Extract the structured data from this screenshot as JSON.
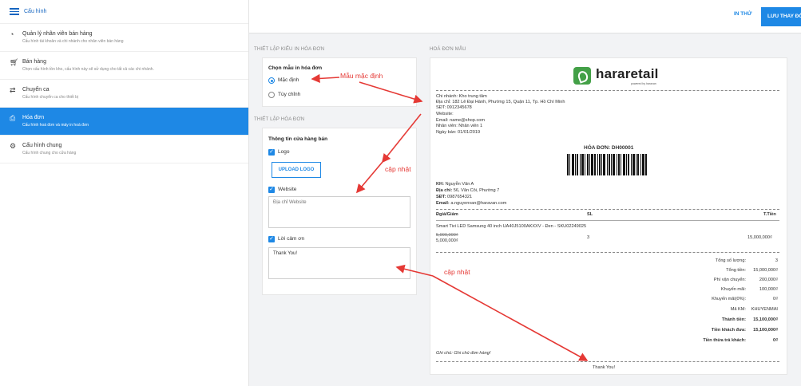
{
  "sidebar": {
    "title": "Cấu hình",
    "items": [
      {
        "label": "Quản lý nhân viên bán hàng",
        "sub": "Cấu hình tài khoản và chi nhánh cho nhân viên bán hàng"
      },
      {
        "label": "Bán hàng",
        "sub": "Chọn cấu hình tồn kho, cấu hình này sẽ sử dụng cho tất cả các chi nhánh."
      },
      {
        "label": "Chuyển ca",
        "sub": "Cấu hình chuyển ca cho thiết bị"
      },
      {
        "label": "Hóa đơn",
        "sub": "Cấu hình hoá đơn và máy in hoá đơn"
      },
      {
        "label": "Cấu hình chung",
        "sub": "Cấu hình chung cho cửa hàng"
      }
    ]
  },
  "topbar": {
    "print_label": "IN THỬ",
    "save_label": "LƯU THAY ĐỔI"
  },
  "settings": {
    "print_section_title": "THIẾT LẬP KIỂU IN HÓA ĐƠN",
    "template_label": "Chọn mẫu in hóa đơn",
    "option_default": "Mặc định",
    "option_custom": "Tùy chỉnh",
    "invoice_section_title": "THIẾT LẬP HÓA ĐƠN",
    "store_info_label": "Thông tin cửa hàng bán",
    "logo_label": "Logo",
    "upload_label": "UPLOAD LOGO",
    "website_label": "Website",
    "website_placeholder": "Địa chỉ Website",
    "thanks_label": "Lời cảm ơn",
    "thanks_value": "Thank You!"
  },
  "preview": {
    "section_title": "HOÁ ĐƠN MẪU",
    "logo_text": "hararetail",
    "logo_sub": "powered by haravan",
    "store_lines": [
      "Chi nhánh: Kho trung tâm",
      "Địa chỉ: 182 Lê Đại Hành, Phường 15, Quận 11, Tp. Hồ Chí Minh",
      "SĐT: 0912345678",
      "Website:",
      "Email: name@shop.com",
      "Nhân viên: Nhân viên 1",
      "Ngày bán: 01/01/2019"
    ],
    "invoice_no": "HÓA ĐƠN: DH00001",
    "customer": {
      "name_k": "KH:",
      "name_v": "Nguyễn Văn A",
      "addr_k": "Địa chỉ:",
      "addr_v": "56, Văn Côi, Phường 7",
      "phone_k": "SĐT:",
      "phone_v": "0987654321",
      "email_k": "Email:",
      "email_v": "a.nguyenvan@haravan.com"
    },
    "table_head": {
      "price": "Đgiá/Giảm",
      "qty": "SL",
      "total": "T.Tiền"
    },
    "product_name": "Smart Tivi LED Samsung 40 inch UA40J5100AKXXV - Đen - SKU02249025",
    "product_old_price": "5,990,000₫",
    "product_price": "5,000,000₫",
    "product_qty": "3",
    "product_total": "15,000,000₫",
    "summary": [
      {
        "k": "Tổng số lượng:",
        "v": "3",
        "bold": false
      },
      {
        "k": "Tổng tiền:",
        "v": "15,000,000₫",
        "bold": false
      },
      {
        "k": "Phí vận chuyển:",
        "v": "200,000₫",
        "bold": false
      },
      {
        "k": "Khuyến mãi:",
        "v": "100,000₫",
        "bold": false
      },
      {
        "k": "Khuyến mãi(0%):",
        "v": "0₫",
        "bold": false
      },
      {
        "k": "Mã KM:",
        "v": "KHUYENMAI",
        "bold": false
      },
      {
        "k": "Thành tiền:",
        "v": "15,100,000₫",
        "bold": true
      },
      {
        "k": "Tiền khách đưa:",
        "v": "15,100,000₫",
        "bold": true
      },
      {
        "k": "Tiền thừa trả khách:",
        "v": "0₫",
        "bold": true
      }
    ],
    "note": "Ghi chú: Ghi chú đơn hàng!",
    "thanks": "Thank You!"
  },
  "annotations": {
    "default_template": "Mẫu mặc định",
    "update_1": "cập nhật",
    "update_2": "cập nhật"
  },
  "colors": {
    "accent": "#1e88e5",
    "annotation": "#e53935",
    "brand_green": "#43a047"
  }
}
